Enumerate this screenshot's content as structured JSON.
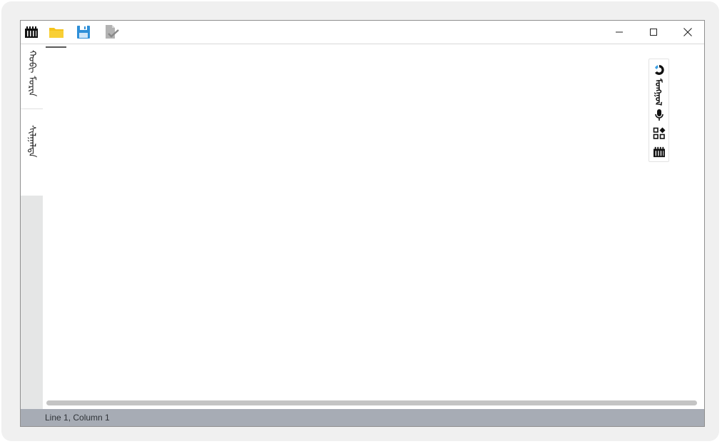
{
  "toolbar": {
    "icons": [
      "app-logo-icon",
      "open-folder-icon",
      "save-icon",
      "check-document-icon"
    ]
  },
  "window_controls": [
    "minimize",
    "maximize",
    "close"
  ],
  "side_tabs": [
    {
      "label": "ᠬᠤᠪᠢ ᠮᠣᠷᠢᠨ"
    },
    {
      "label": "ᠰᠢᠯᠭᠠᠯᠲᠠ"
    }
  ],
  "floating_toolbar": {
    "items": [
      "pie-chart-icon",
      "mongolian-script-icon",
      "microphone-icon",
      "apps-icon",
      "app-logo-icon"
    ],
    "script_label": "ᠮᠣᠩᠭᠣᠯ"
  },
  "status": {
    "position": "Line 1, Column 1"
  },
  "colors": {
    "folder": "#f5c31c",
    "save": "#2e8fd8",
    "status_bar": "#a7acb5",
    "accent_blue": "#3ba0e6"
  }
}
